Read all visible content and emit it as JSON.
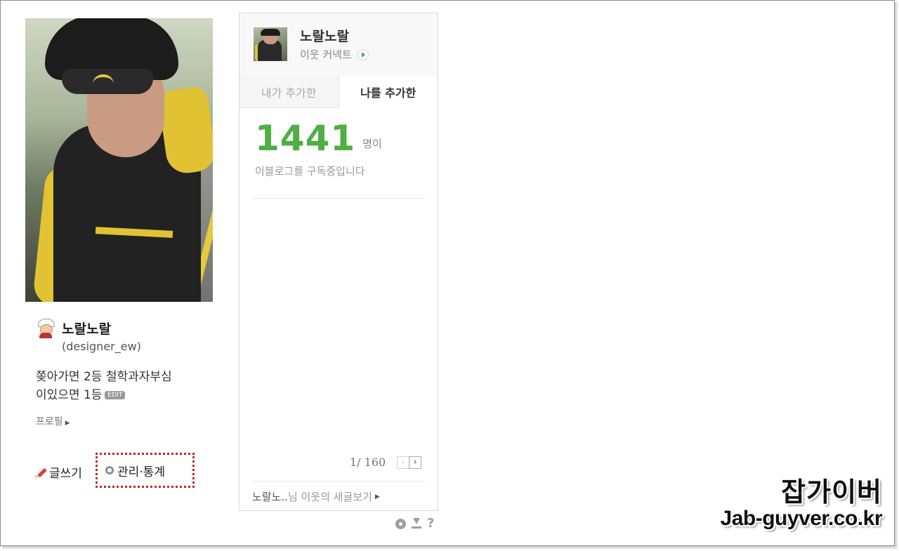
{
  "profile": {
    "nickname": "노랄노랄",
    "user_id": "(designer_ew)",
    "bio_line1": "쫒아가면 2등 철학과자부심",
    "bio_line2": "이있으면 1등",
    "edit_badge": "EDIT",
    "profile_link": "프로필",
    "write_label": "글쓰기",
    "manage_label": "관리·통계"
  },
  "widget": {
    "name": "노랄노랄",
    "connect_label": "이웃 커넥트",
    "tabs": [
      {
        "label": "내가 추가한",
        "active": false
      },
      {
        "label": "나를 추가한",
        "active": true
      }
    ],
    "count": "1441",
    "count_unit": "명이",
    "count_desc": "이블로그를 구독중입니다",
    "pager": "1/ 160",
    "footer_name": "노랄노..",
    "footer_text": "님 이웃의 새글보기"
  },
  "tools": {
    "icons": [
      "gear-icon",
      "download-icon",
      "help-icon"
    ],
    "help": "?"
  },
  "watermark": {
    "line1": "잡가이버",
    "line2": "Jab-guyver.co.kr"
  },
  "colors": {
    "count_green": "#4fae44",
    "highlight_red": "#c0272d"
  }
}
